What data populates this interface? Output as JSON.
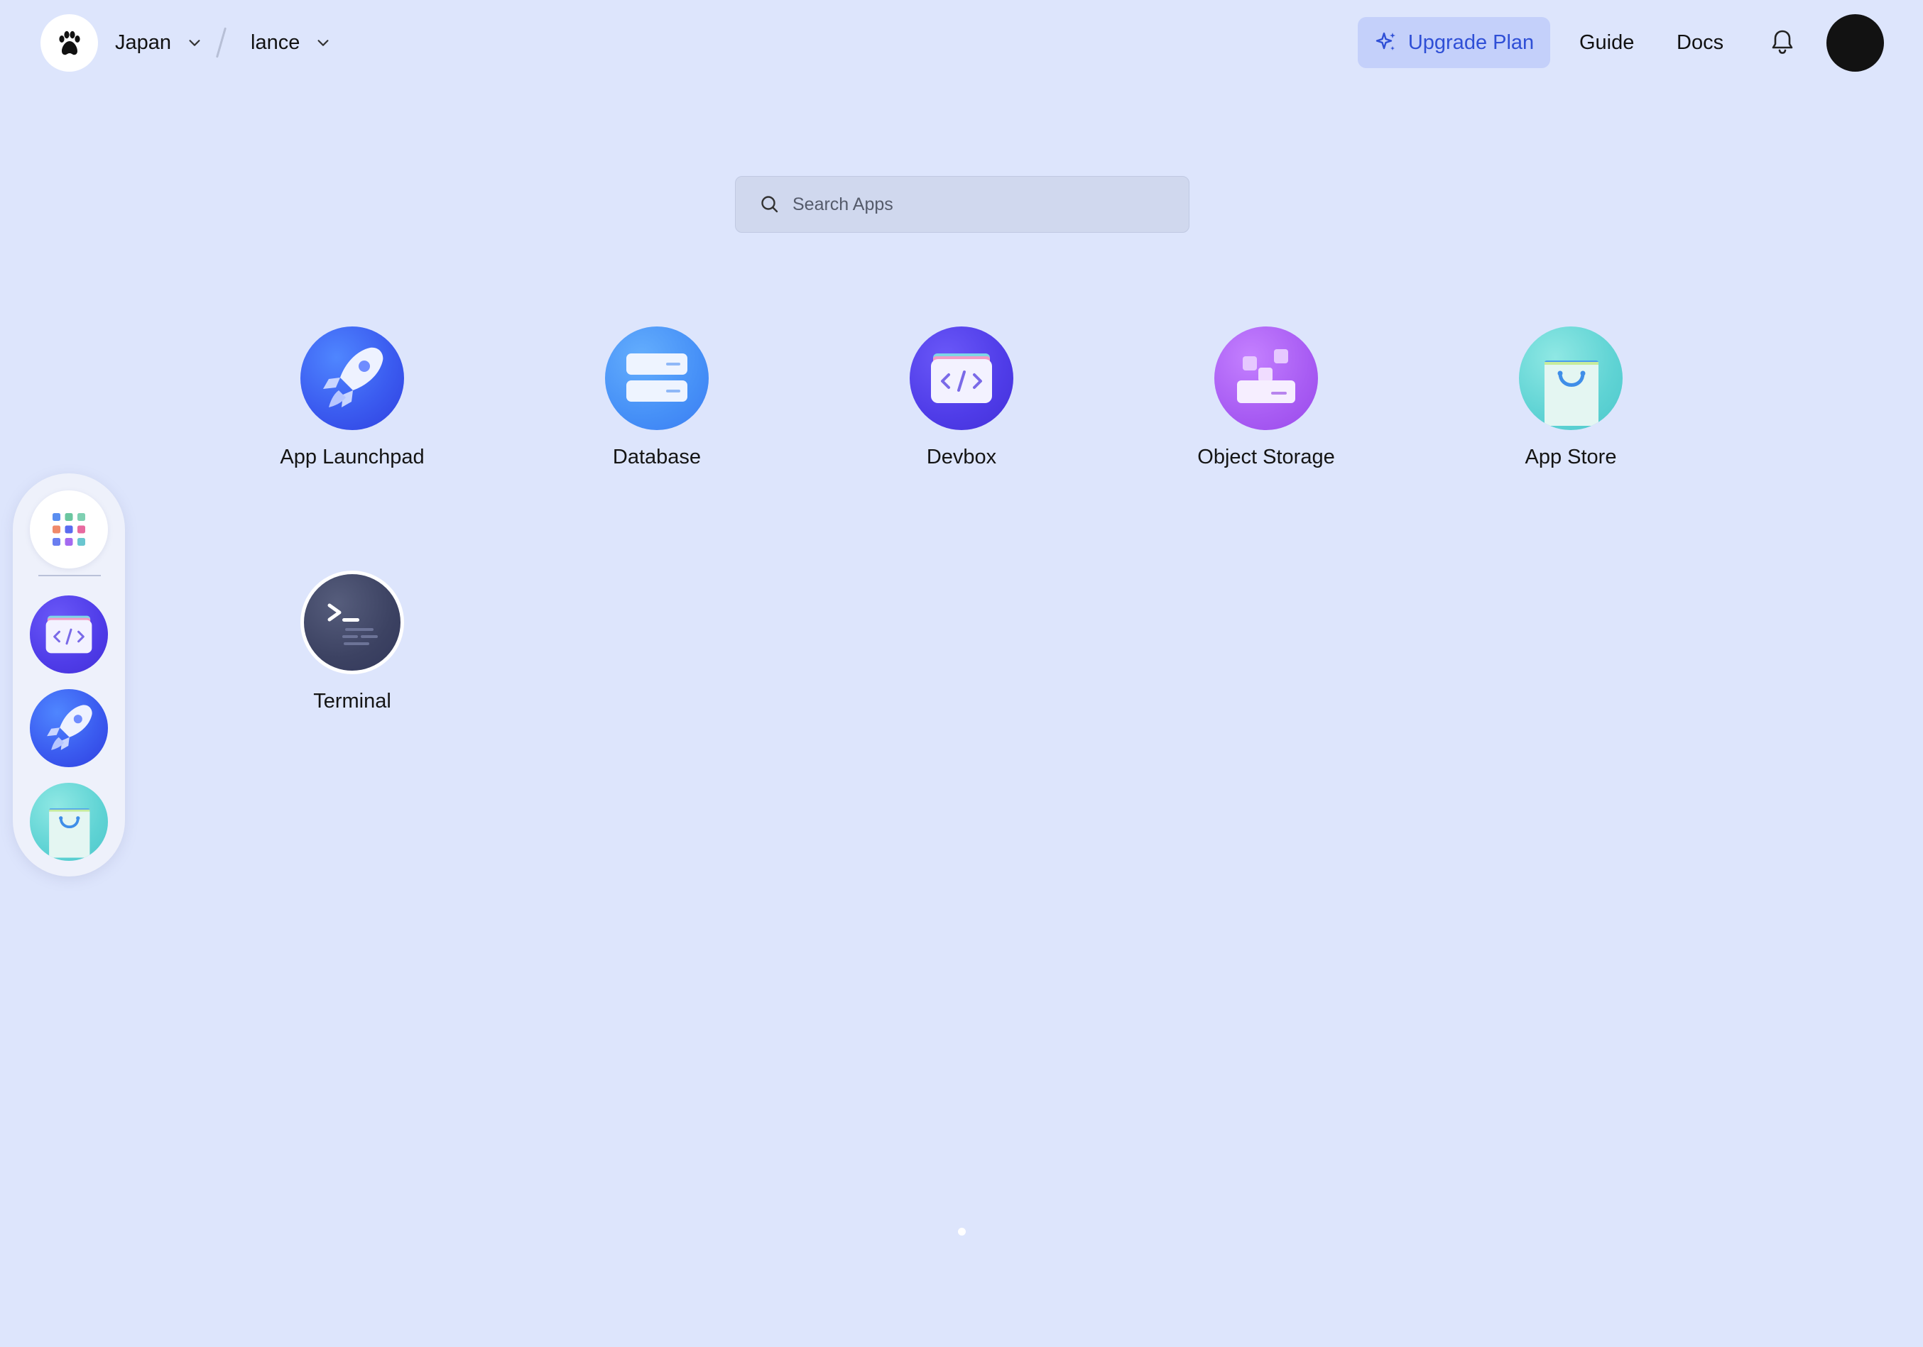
{
  "topbar": {
    "region": "Japan",
    "workspace": "lance",
    "upgrade_label": "Upgrade Plan",
    "guide_label": "Guide",
    "docs_label": "Docs"
  },
  "search": {
    "placeholder": "Search Apps",
    "value": ""
  },
  "apps": [
    {
      "label": "App Launchpad",
      "icon": "rocket-icon"
    },
    {
      "label": "Database",
      "icon": "database-icon"
    },
    {
      "label": "Devbox",
      "icon": "devbox-code-icon"
    },
    {
      "label": "Object Storage",
      "icon": "object-storage-icon"
    },
    {
      "label": "App Store",
      "icon": "shopping-bag-icon"
    },
    {
      "label": "Terminal",
      "icon": "terminal-icon"
    }
  ],
  "dock": {
    "items": [
      "app-grid-icon",
      "devbox-code-icon",
      "rocket-icon",
      "shopping-bag-icon"
    ]
  },
  "pagination": {
    "current_page": 1,
    "total_pages": 1
  },
  "colors": {
    "background": "#dde5fc",
    "accent": "#2f4fd6",
    "upgrade_bg": "#c4d0fa"
  }
}
